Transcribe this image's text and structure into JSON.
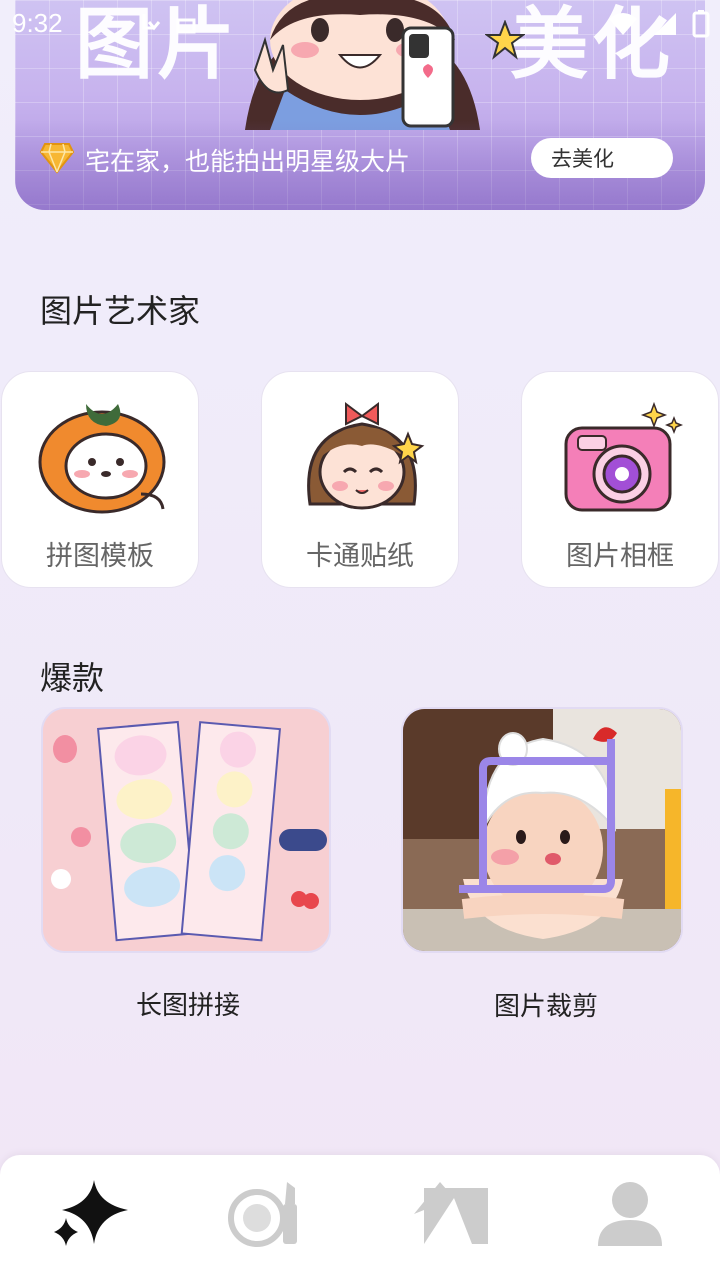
{
  "status_bar": {
    "time": "9:32"
  },
  "banner": {
    "big_text_left": "图片",
    "big_text_right": "美化",
    "caption": "宅在家，也能拍出明星级大片",
    "button_label": "去美化"
  },
  "art_section": {
    "title": "图片艺术家",
    "tools": [
      {
        "label": "拼图模板",
        "icon": "persimmon-puppy-icon"
      },
      {
        "label": "卡通贴纸",
        "icon": "cartoon-girl-icon"
      },
      {
        "label": "图片相框",
        "icon": "instant-camera-icon"
      }
    ]
  },
  "hot_section": {
    "title": "爆款",
    "items": [
      {
        "label": "长图拼接",
        "image": "long-collage-image"
      },
      {
        "label": "图片裁剪",
        "image": "crop-photo-image"
      }
    ]
  },
  "tabbar": {
    "tabs": [
      {
        "icon": "sparkle-icon",
        "active": true
      },
      {
        "icon": "makeup-icon",
        "active": false
      },
      {
        "icon": "photo-collage-icon",
        "active": false
      },
      {
        "icon": "profile-icon",
        "active": false
      }
    ]
  },
  "colors": {
    "accent_purple": "#8f78e6",
    "banner": "#c7b3ee",
    "background": "#f1eefb"
  }
}
